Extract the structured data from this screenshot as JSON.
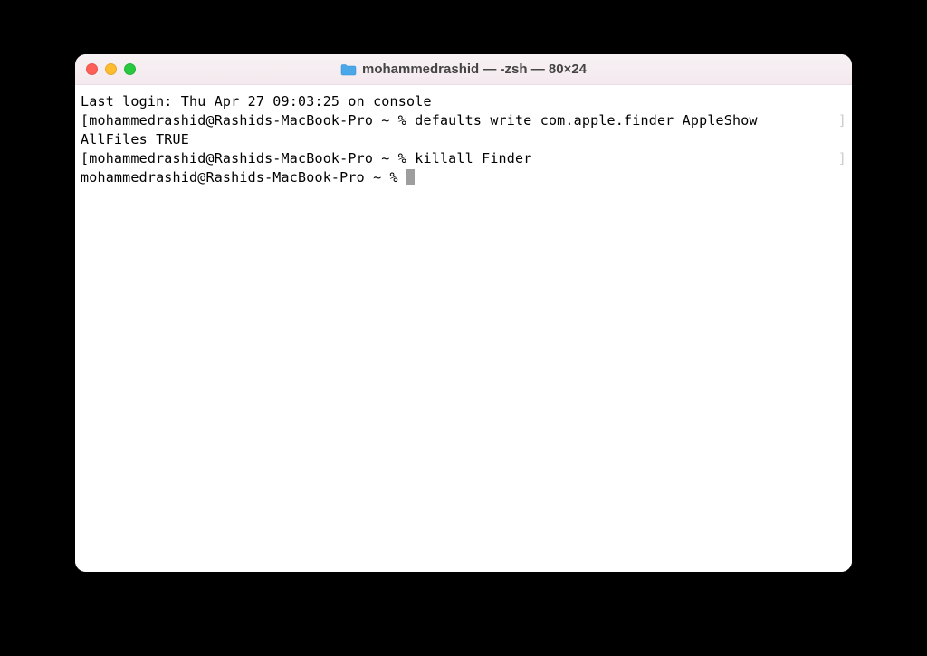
{
  "window": {
    "title": "mohammedrashid — -zsh — 80×24",
    "icon_name": "folder-icon"
  },
  "terminal": {
    "last_login": "Last login: Thu Apr 27 09:03:25 on console",
    "prompt": "mohammedrashid@Rashids-MacBook-Pro ~ %",
    "command1_part1": "defaults write com.apple.finder AppleShow",
    "command1_part2": "AllFiles TRUE",
    "command2": "killall Finder",
    "left_bracket": "[",
    "right_bracket": "]"
  }
}
